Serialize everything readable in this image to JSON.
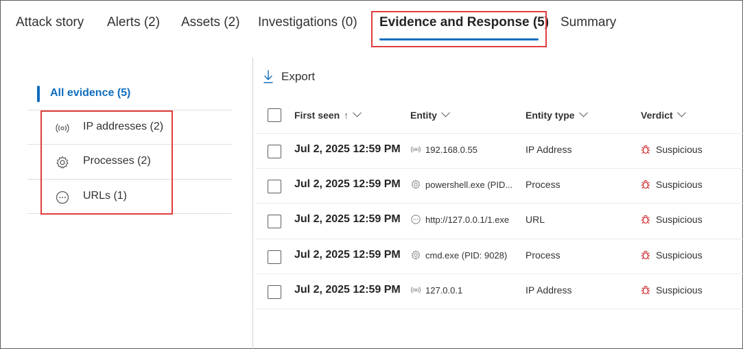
{
  "tabs": [
    {
      "label": "Attack story"
    },
    {
      "label": "Alerts (2)"
    },
    {
      "label": "Assets (2)"
    },
    {
      "label": "Investigations (0)"
    },
    {
      "label": "Evidence and Response (5)",
      "active": true
    },
    {
      "label": "Summary"
    }
  ],
  "left_pane": {
    "all_evidence": "All evidence (5)",
    "categories": [
      {
        "label": "IP addresses (2)",
        "icon": "broadcast-icon"
      },
      {
        "label": "Processes (2)",
        "icon": "gear-icon"
      },
      {
        "label": "URLs (1)",
        "icon": "link-icon"
      }
    ]
  },
  "toolbar": {
    "export_label": "Export"
  },
  "table": {
    "columns": {
      "first_seen": "First seen",
      "entity": "Entity",
      "entity_type": "Entity type",
      "verdict": "Verdict"
    },
    "rows": [
      {
        "first_seen": "Jul 2, 2025 12:59 PM",
        "entity": "192.168.0.55",
        "entity_icon": "broadcast-icon",
        "entity_type": "IP Address",
        "verdict": "Suspicious"
      },
      {
        "first_seen": "Jul 2, 2025 12:59 PM",
        "entity": "powershell.exe (PID...",
        "entity_icon": "gear-icon",
        "entity_type": "Process",
        "verdict": "Suspicious"
      },
      {
        "first_seen": "Jul 2, 2025 12:59 PM",
        "entity": "http://127.0.0.1/1.exe",
        "entity_icon": "link-icon",
        "entity_type": "URL",
        "verdict": "Suspicious"
      },
      {
        "first_seen": "Jul 2, 2025 12:59 PM",
        "entity": "cmd.exe (PID: 9028)",
        "entity_icon": "gear-icon",
        "entity_type": "Process",
        "verdict": "Suspicious"
      },
      {
        "first_seen": "Jul 2, 2025 12:59 PM",
        "entity": "127.0.0.1",
        "entity_icon": "broadcast-icon",
        "entity_type": "IP Address",
        "verdict": "Suspicious"
      }
    ]
  },
  "colors": {
    "accent": "#0f6cbd",
    "highlight": "#e03c3c",
    "suspicious": "#d13438"
  }
}
